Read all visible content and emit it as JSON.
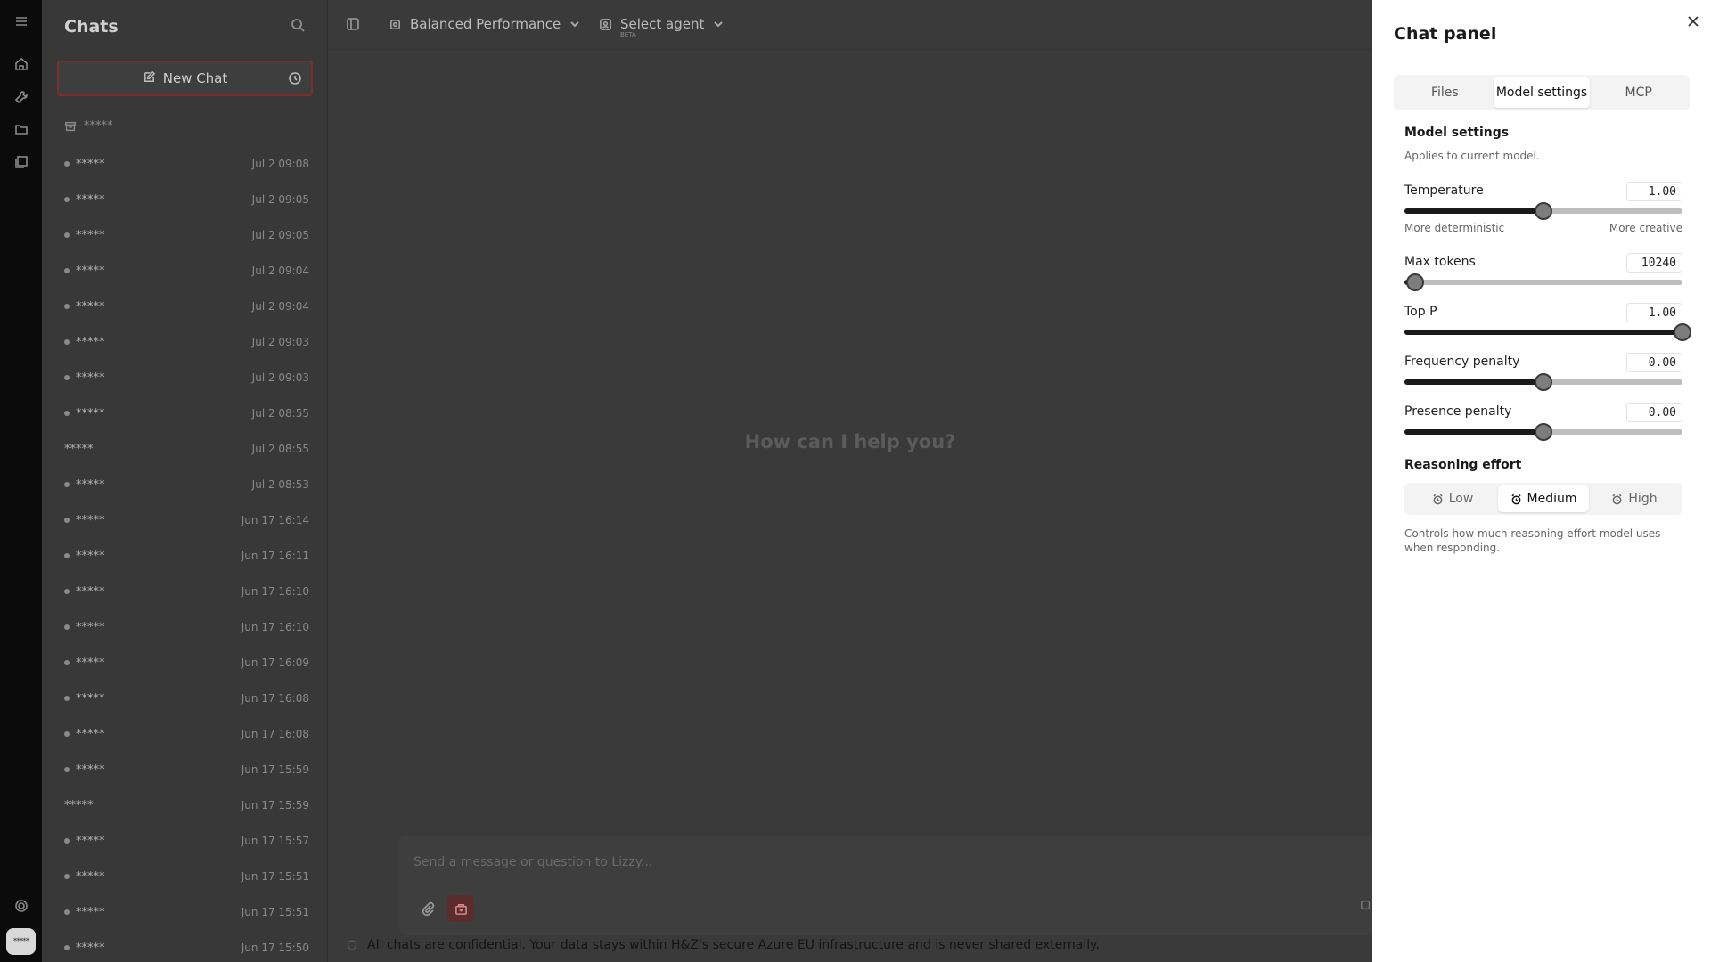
{
  "sidebar": {
    "title": "Chats",
    "new_chat_label": "New Chat",
    "archive_label": "*****",
    "chats": [
      {
        "name": "*****",
        "time": "Jul 2 09:08",
        "dot": true
      },
      {
        "name": "*****",
        "time": "Jul 2 09:05",
        "dot": true
      },
      {
        "name": "*****",
        "time": "Jul 2 09:05",
        "dot": true
      },
      {
        "name": "*****",
        "time": "Jul 2 09:04",
        "dot": true
      },
      {
        "name": "*****",
        "time": "Jul 2 09:04",
        "dot": true
      },
      {
        "name": "*****",
        "time": "Jul 2 09:03",
        "dot": true
      },
      {
        "name": "*****",
        "time": "Jul 2 09:03",
        "dot": true
      },
      {
        "name": "*****",
        "time": "Jul 2 08:55",
        "dot": true
      },
      {
        "name": "*****",
        "time": "Jul 2 08:55",
        "dot": false
      },
      {
        "name": "*****",
        "time": "Jul 2 08:53",
        "dot": true
      },
      {
        "name": "*****",
        "time": "Jun 17 16:14",
        "dot": true
      },
      {
        "name": "*****",
        "time": "Jun 17 16:11",
        "dot": true
      },
      {
        "name": "*****",
        "time": "Jun 17 16:10",
        "dot": true
      },
      {
        "name": "*****",
        "time": "Jun 17 16:10",
        "dot": true
      },
      {
        "name": "*****",
        "time": "Jun 17 16:09",
        "dot": true
      },
      {
        "name": "*****",
        "time": "Jun 17 16:08",
        "dot": true
      },
      {
        "name": "*****",
        "time": "Jun 17 16:08",
        "dot": true
      },
      {
        "name": "*****",
        "time": "Jun 17 15:59",
        "dot": true
      },
      {
        "name": "*****",
        "time": "Jun 17 15:59",
        "dot": false
      },
      {
        "name": "*****",
        "time": "Jun 17 15:57",
        "dot": true
      },
      {
        "name": "*****",
        "time": "Jun 17 15:51",
        "dot": true
      },
      {
        "name": "*****",
        "time": "Jun 17 15:51",
        "dot": true
      },
      {
        "name": "*****",
        "time": "Jun 17 15:50",
        "dot": true
      }
    ]
  },
  "rail": {
    "avatar_text": "*****"
  },
  "topbar": {
    "model_label": "Balanced Performance",
    "agent_label": "Select agent",
    "agent_badge": "BETA"
  },
  "main": {
    "greeting": "How can I help you?",
    "input_placeholder": "Send a message or question to Lizzy...",
    "footer_note": "All chats are confidential. Your data stays within H&Z's secure Azure EU infrastructure and is never shared externally."
  },
  "panel": {
    "title": "Chat panel",
    "tabs": [
      {
        "label": "Files",
        "active": false
      },
      {
        "label": "Model settings",
        "active": true
      },
      {
        "label": "MCP",
        "active": false
      }
    ],
    "section_title": "Model settings",
    "section_subtitle": "Applies to current model.",
    "settings": [
      {
        "key": "temperature",
        "label": "Temperature",
        "value": "1.00",
        "fraction": 0.5,
        "hint_left": "More deterministic",
        "hint_right": "More creative"
      },
      {
        "key": "max-tokens",
        "label": "Max tokens",
        "value": "10240",
        "fraction": 0.04
      },
      {
        "key": "top-p",
        "label": "Top P",
        "value": "1.00",
        "fraction": 1.0
      },
      {
        "key": "frequency-penalty",
        "label": "Frequency penalty",
        "value": "0.00",
        "fraction": 0.5
      },
      {
        "key": "presence-penalty",
        "label": "Presence penalty",
        "value": "0.00",
        "fraction": 0.5
      }
    ],
    "reasoning": {
      "title": "Reasoning effort",
      "options": [
        {
          "label": "Low",
          "active": false
        },
        {
          "label": "Medium",
          "active": true
        },
        {
          "label": "High",
          "active": false
        }
      ],
      "description": "Controls how much reasoning effort model uses when responding."
    }
  },
  "colors": {
    "accent_border": "#7a2e2e",
    "slider_fill": "#1a1a1a",
    "slider_track": "#bdbdbd"
  }
}
